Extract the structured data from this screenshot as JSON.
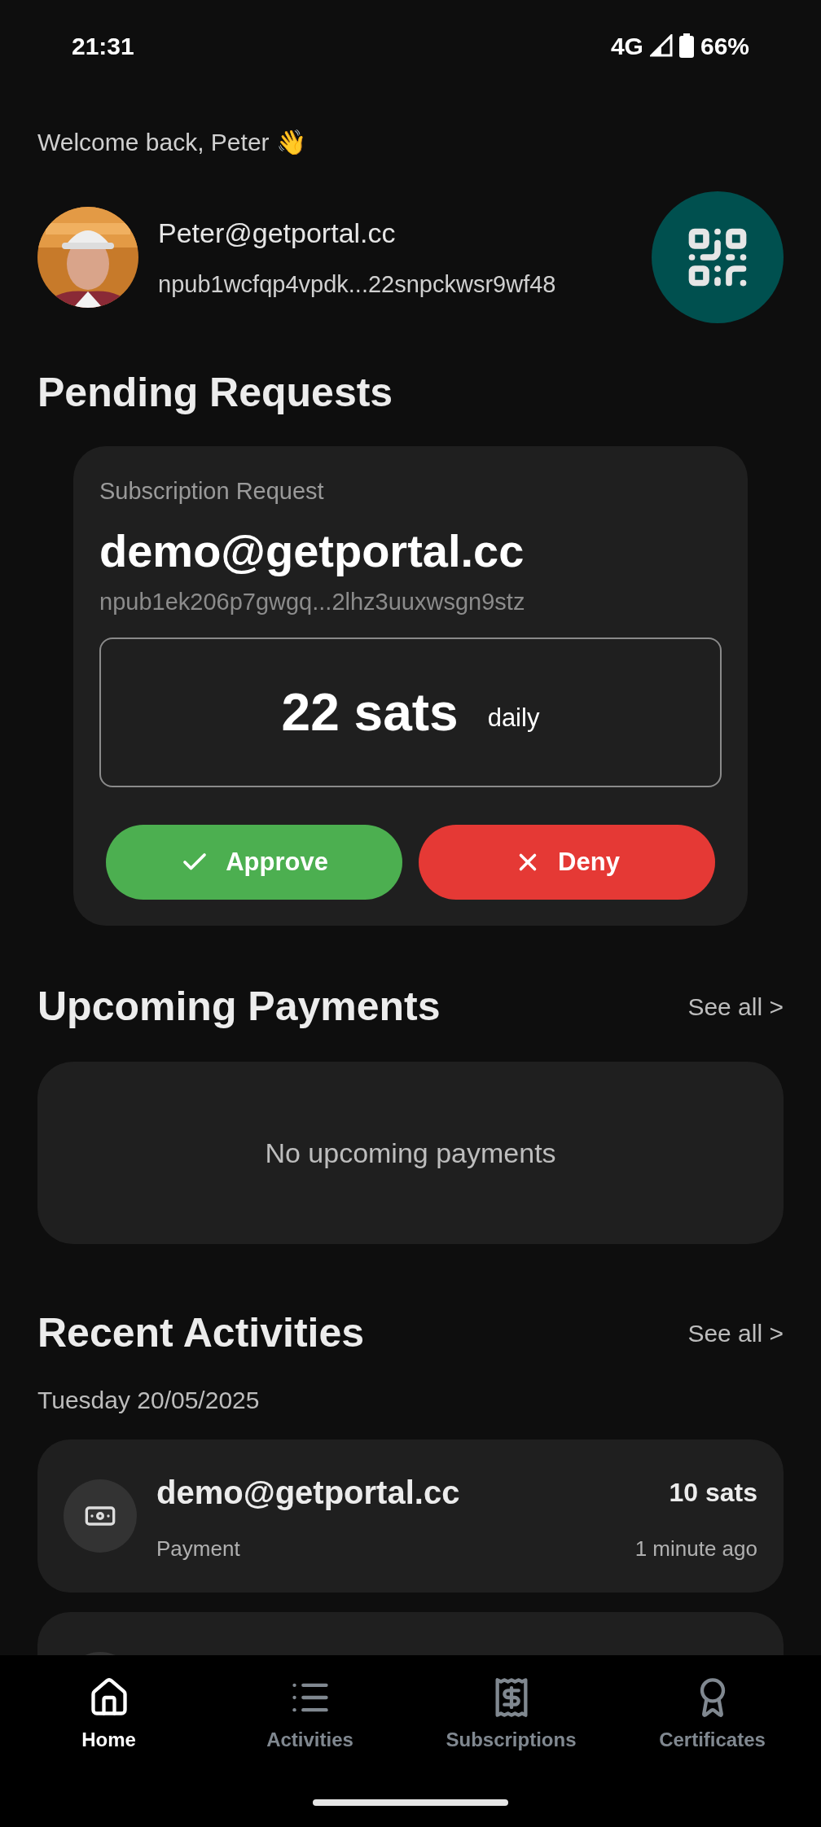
{
  "status_bar": {
    "time": "21:31",
    "network": "4G",
    "battery": "66%"
  },
  "greeting": "Welcome back, Peter 👋",
  "profile": {
    "name": "Peter@getportal.cc",
    "npub": "npub1wcfqp4vpdk...22snpckwsr9wf48"
  },
  "pending_requests": {
    "title": "Pending Requests",
    "requests": [
      {
        "type": "Subscription Request",
        "name": "demo@getportal.cc",
        "npub": "npub1ek206p7gwgq...2lhz3uuxwsgn9stz",
        "amount": "22 sats",
        "period": "daily",
        "approve": "Approve",
        "deny": "Deny"
      }
    ]
  },
  "upcoming_payments": {
    "title": "Upcoming Payments",
    "see_all": "See all >",
    "empty_text": "No upcoming payments"
  },
  "recent_activities": {
    "title": "Recent Activities",
    "see_all": "See all >",
    "date": "Tuesday 20/05/2025",
    "items": [
      {
        "name": "demo@getportal.cc",
        "type": "Payment",
        "amount": "10 sats",
        "time": "1 minute ago"
      }
    ]
  },
  "nav": [
    {
      "label": "Home",
      "selected": true
    },
    {
      "label": "Activities",
      "selected": false
    },
    {
      "label": "Subscriptions",
      "selected": false
    },
    {
      "label": "Certificates",
      "selected": false
    }
  ]
}
